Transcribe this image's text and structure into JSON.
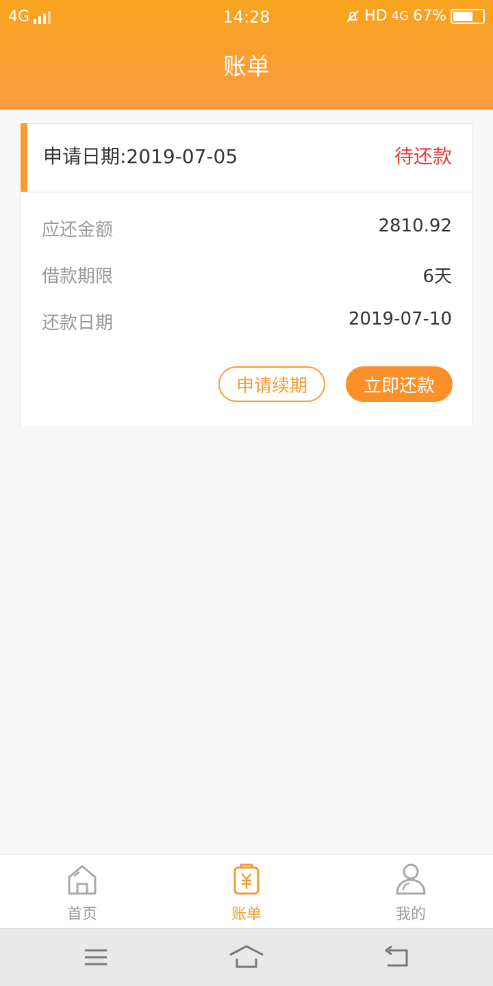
{
  "status_bar": {
    "network": "4G",
    "time": "14:28",
    "hd": "HD",
    "network2": "4G",
    "battery": "67%",
    "battery_level": 0.67
  },
  "header": {
    "title": "账单"
  },
  "bill": {
    "apply_date_label": "申请日期:2019-07-05",
    "status": "待还款",
    "rows": [
      {
        "label": "应还金额",
        "value": "2810.92"
      },
      {
        "label": "借款期限",
        "value": "6天"
      },
      {
        "label": "还款日期",
        "value": "2019-07-10"
      }
    ],
    "renew_button": "申请续期",
    "repay_button": "立即还款"
  },
  "tabbar": {
    "items": [
      {
        "label": "首页",
        "icon": "home-icon",
        "active": false
      },
      {
        "label": "账单",
        "icon": "bill-icon",
        "active": true
      },
      {
        "label": "我的",
        "icon": "user-icon",
        "active": false
      }
    ]
  },
  "system_nav": {
    "icons": [
      "menu-icon",
      "home-nav-icon",
      "back-icon"
    ]
  },
  "colors": {
    "accent": "#fb9a2e",
    "status_red": "#e8393a"
  }
}
